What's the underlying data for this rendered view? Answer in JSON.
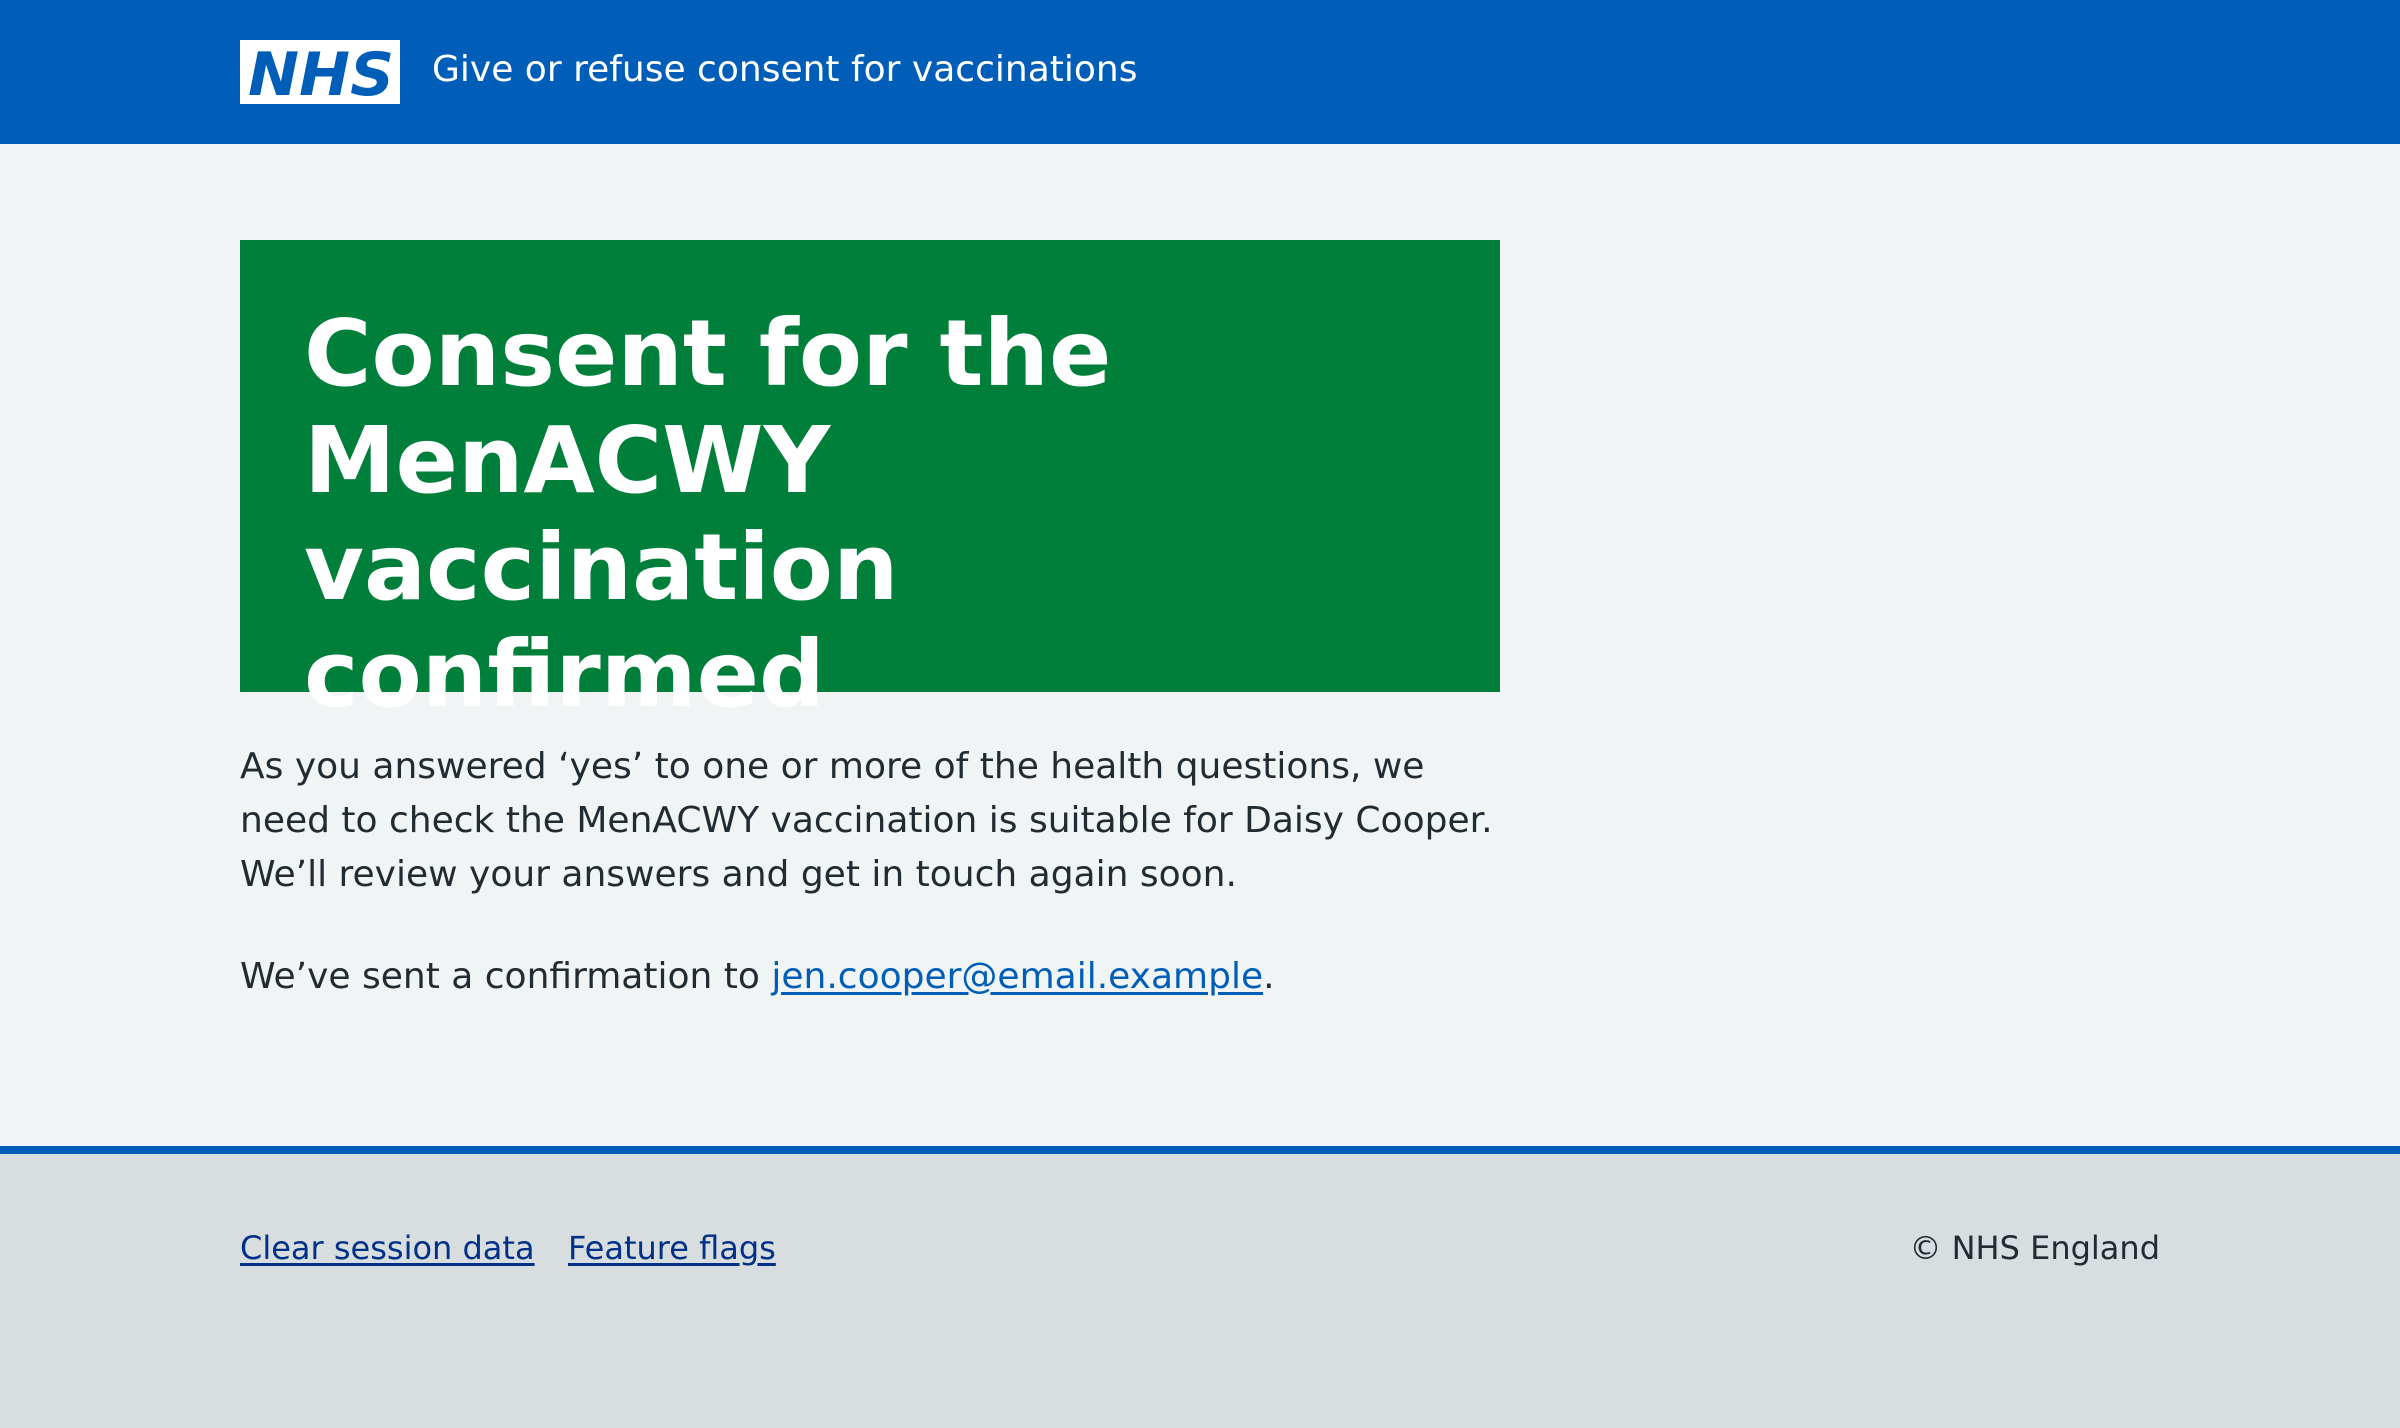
{
  "header": {
    "logo_text": "NHS",
    "service_name": "Give or refuse consent for vaccinations",
    "background_color": "#005eb8"
  },
  "confirmation_panel": {
    "title": "Consent for the MenACWY vaccination confirmed",
    "background_color": "#007f3b"
  },
  "body": {
    "paragraph_1": "As you answered ‘yes’ to one or more of the health questions, we need to check the MenACWY vaccination is suitable for Daisy Cooper. We’ll review your answers and get in touch again soon.",
    "paragraph_2_prefix": "We’ve sent a confirmation to ",
    "email_link": "jen.cooper@email.example",
    "paragraph_2_suffix": "."
  },
  "footer": {
    "links": [
      {
        "label": "Clear session data"
      },
      {
        "label": "Feature flags"
      }
    ],
    "copyright": "© NHS England"
  }
}
